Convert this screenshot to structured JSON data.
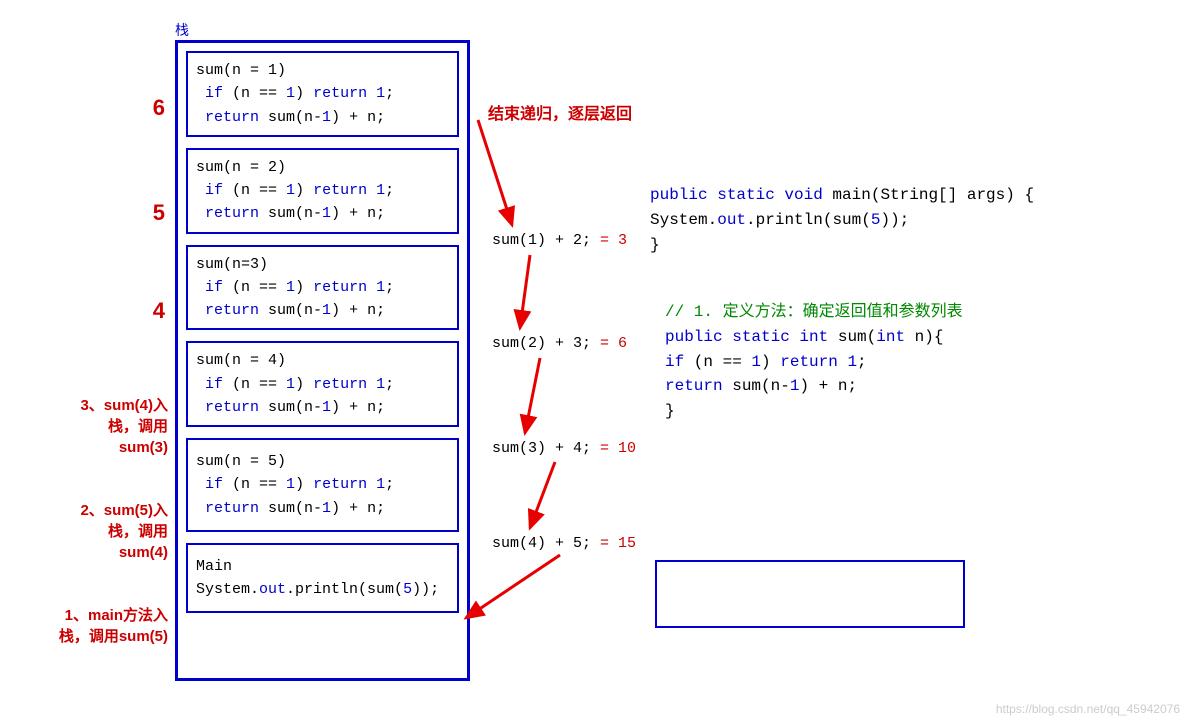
{
  "stack_title": "栈",
  "left_labels": {
    "l6": "6",
    "l5": "5",
    "l4": "4",
    "l3": "3、sum(4)入栈，调用sum(3)",
    "l2": "2、sum(5)入栈，调用sum(4)",
    "l1": "1、main方法入栈，调用sum(5)"
  },
  "top_annotation": "结束递归，逐层返回",
  "frames": {
    "f6": {
      "header": "sum(n = 1)"
    },
    "f5": {
      "header": "sum(n = 2)"
    },
    "f4": {
      "header": "sum(n=3)"
    },
    "f3": {
      "header": "sum(n = 4)"
    },
    "f2": {
      "header": "sum(n = 5)"
    },
    "f1_line1": "Main"
  },
  "common_code": {
    "if_prefix": "if (n == ",
    "if_val": "1",
    "if_mid": ") ",
    "return_kw": "return",
    "one": "1",
    "semi": ";",
    "ret_sum_prefix": "return sum(n-",
    "ret_sum_mid": ") + n;"
  },
  "results": {
    "r1": {
      "left": "sum(1) + 2;",
      "eq": " = 3"
    },
    "r2": {
      "left": "sum(2) + 3;",
      "eq": " = 6"
    },
    "r3": {
      "left": "sum(3) + 4;",
      "eq": " = 10"
    },
    "r4": {
      "left": "sum(4) + 5;",
      "eq": " = 15"
    }
  },
  "code_main": {
    "l1_pre": "public static void",
    "l1_fn": " main(String[] args) {",
    "l2_pre": "    System.",
    "l2_out": "out",
    "l2_mid": ".println(sum(",
    "l2_arg": "5",
    "l2_end": "));",
    "l3": "}"
  },
  "code_sum": {
    "comment": "//  1. 定义方法：确定返回值和参数列表",
    "l1_pre": "public static int",
    "l1_fn": " sum(",
    "l1_kw2": "int",
    "l1_end": " n){",
    "l2_ind": "    ",
    "l2_if": "if",
    "l2_mid": " (n == ",
    "l2_one": "1",
    "l2_mid2": ") ",
    "l2_ret": "return",
    "l2_one2": " 1",
    "l2_semi": ";",
    "l3_ind": "    ",
    "l3_ret": "return",
    "l3_mid": " sum(n-",
    "l3_one": "1",
    "l3_end": ") + n;",
    "l4": "}"
  },
  "main_frame": {
    "sys": "System.",
    "out": "out",
    "print": ".println(sum(",
    "arg": "5",
    "end": "));"
  },
  "watermark": "https://blog.csdn.net/qq_45942076"
}
